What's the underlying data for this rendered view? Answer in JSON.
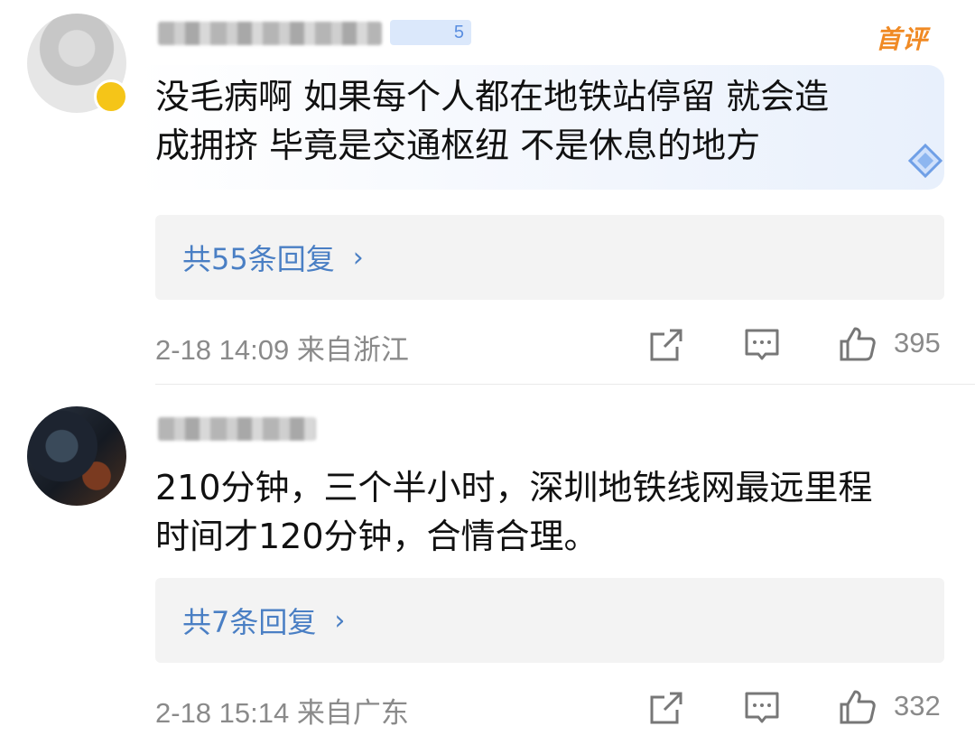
{
  "comments": [
    {
      "username": "",
      "level": "5",
      "tag": "首评",
      "text_lines": [
        "没毛病啊 如果每个人都在地铁站停留 就会造",
        "成拥挤 毕竟是交通枢纽 不是休息的地方"
      ],
      "reply_link": "共55条回复",
      "meta": "2-18 14:09 来自浙江",
      "likes": "395",
      "icons": [
        "share-icon",
        "comment-icon",
        "like-icon"
      ]
    },
    {
      "username": "",
      "text_lines": [
        "210分钟，三个半小时，深圳地铁线网最远里程",
        "时间才120分钟，合情合理。"
      ],
      "reply_link": "共7条回复",
      "meta": "2-18 15:14 来自广东",
      "likes": "332",
      "icons": [
        "share-icon",
        "comment-icon",
        "like-icon"
      ]
    }
  ],
  "colors": {
    "link": "#4a7fc4",
    "meta": "#8a8a8a",
    "tag": "#f08a24",
    "reply_bg": "#f3f3f3"
  }
}
